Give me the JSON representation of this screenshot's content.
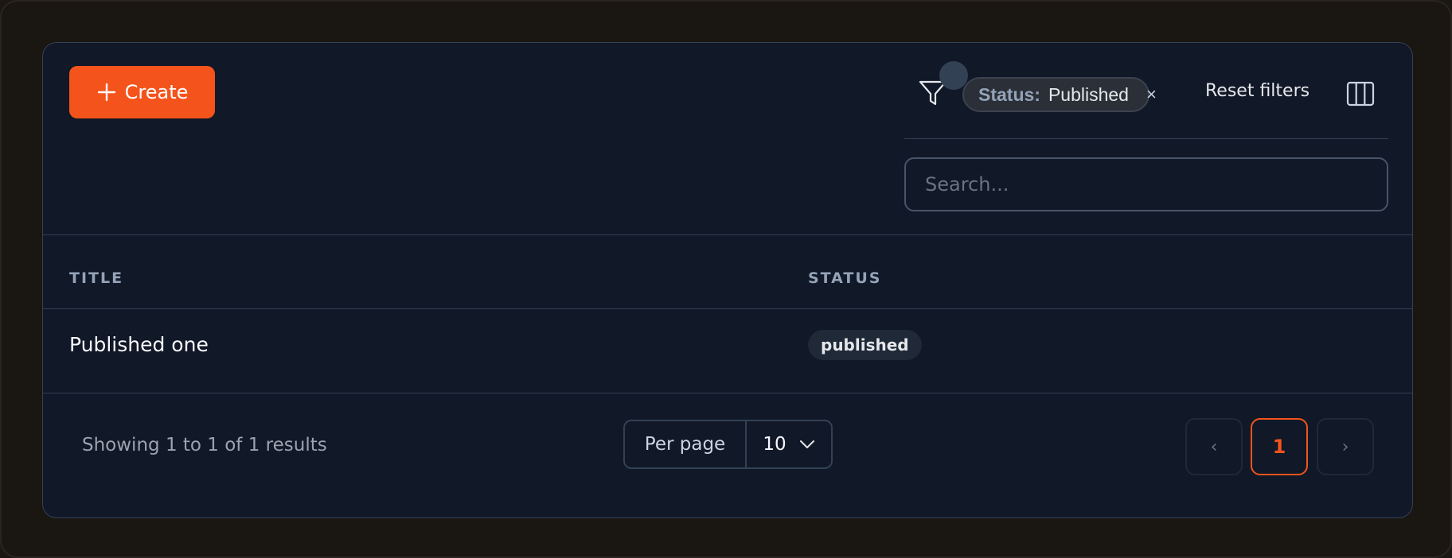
{
  "toolbar": {
    "create_label": "Create",
    "filter_chip": {
      "key": "Status:",
      "value": "Published",
      "remove": "×"
    },
    "reset_label": "Reset filters"
  },
  "search": {
    "placeholder": "Search...",
    "value": ""
  },
  "table": {
    "columns": [
      "TITLE",
      "STATUS"
    ],
    "rows": [
      {
        "title": "Published one",
        "status": "published"
      }
    ]
  },
  "footer": {
    "showing_text": "Showing 1 to 1 of 1 results",
    "per_page_label": "Per page",
    "per_page_value": "10",
    "pagination": {
      "prev": "‹",
      "current": "1",
      "next": "›"
    }
  },
  "colors": {
    "accent": "#f4541c",
    "panel_bg": "#111827",
    "border": "#334155"
  },
  "icons": {
    "create": "plus-icon",
    "filter": "funnel-icon",
    "columns": "columns-icon",
    "dropdown": "chevron-down-icon",
    "chip_remove": "close-icon"
  }
}
